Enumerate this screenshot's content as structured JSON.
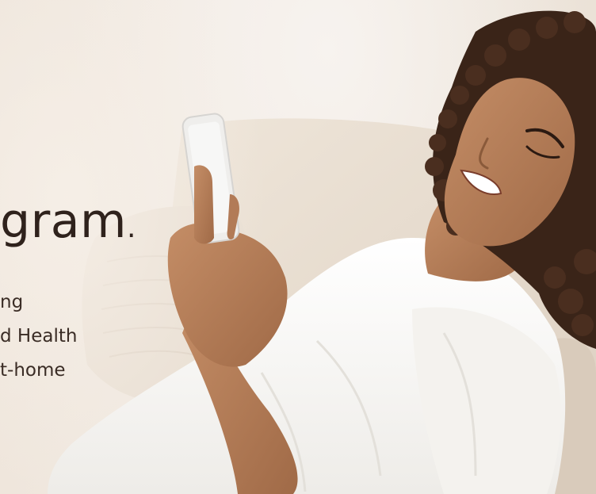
{
  "hero": {
    "headline": "gram",
    "headline_punct": ".",
    "lines": [
      "ng",
      "d Health",
      "t-home"
    ]
  },
  "colors": {
    "background": "#ece3d8",
    "headline_text": "#2f221c",
    "body_text": "#3a2c25",
    "shirt": "#fbfaf8",
    "skin": "#b07a55",
    "hair": "#3a2418",
    "sofa": "#e6dccf",
    "phone": "#efeeec"
  },
  "image": {
    "subject": "woman-smiling-at-phone-on-sofa"
  }
}
